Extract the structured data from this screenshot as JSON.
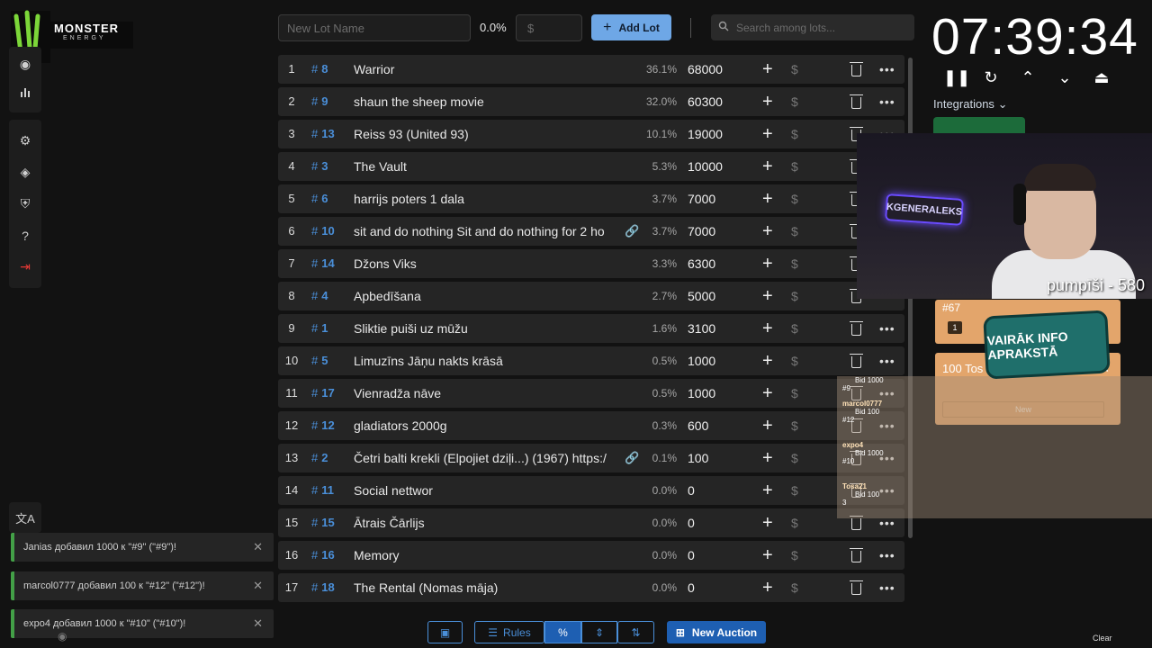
{
  "logo": {
    "text": "MONSTER",
    "sub": "ENERGY"
  },
  "top": {
    "lot_name_placeholder": "New Lot Name",
    "percent": "0.0%",
    "amount_placeholder": "$",
    "add_lot": "Add Lot",
    "search_placeholder": "Search among lots..."
  },
  "lots": [
    {
      "idx": "1",
      "id": "8",
      "name": "Warrior",
      "pct": "36.1%",
      "amount": "68000",
      "link": false
    },
    {
      "idx": "2",
      "id": "9",
      "name": "shaun the sheep movie",
      "pct": "32.0%",
      "amount": "60300",
      "link": false
    },
    {
      "idx": "3",
      "id": "13",
      "name": "Reiss 93 (United 93)",
      "pct": "10.1%",
      "amount": "19000",
      "link": false
    },
    {
      "idx": "4",
      "id": "3",
      "name": "The Vault",
      "pct": "5.3%",
      "amount": "10000",
      "link": false
    },
    {
      "idx": "5",
      "id": "6",
      "name": "harrijs poters 1 dala",
      "pct": "3.7%",
      "amount": "7000",
      "link": false
    },
    {
      "idx": "6",
      "id": "10",
      "name": "sit and do nothing Sit and do nothing for 2 ho",
      "pct": "3.7%",
      "amount": "7000",
      "link": true
    },
    {
      "idx": "7",
      "id": "14",
      "name": "Džons Viks",
      "pct": "3.3%",
      "amount": "6300",
      "link": false
    },
    {
      "idx": "8",
      "id": "4",
      "name": "Apbedīšana",
      "pct": "2.7%",
      "amount": "5000",
      "link": false
    },
    {
      "idx": "9",
      "id": "1",
      "name": "Sliktie puiši uz mūžu",
      "pct": "1.6%",
      "amount": "3100",
      "link": false
    },
    {
      "idx": "10",
      "id": "5",
      "name": "Limuzīns Jāņu nakts krāsā",
      "pct": "0.5%",
      "amount": "1000",
      "link": false
    },
    {
      "idx": "11",
      "id": "17",
      "name": "Vienradža nāve",
      "pct": "0.5%",
      "amount": "1000",
      "link": false
    },
    {
      "idx": "12",
      "id": "12",
      "name": "gladiators 2000g",
      "pct": "0.3%",
      "amount": "600",
      "link": false
    },
    {
      "idx": "13",
      "id": "2",
      "name": "Četri balti krekli (Elpojiet dziļi...) (1967) https:/",
      "pct": "0.1%",
      "amount": "100",
      "link": true
    },
    {
      "idx": "14",
      "id": "11",
      "name": "Social nettwor",
      "pct": "0.0%",
      "amount": "0",
      "link": false
    },
    {
      "idx": "15",
      "id": "15",
      "name": "Ātrais Čārlijs",
      "pct": "0.0%",
      "amount": "0",
      "link": false
    },
    {
      "idx": "16",
      "id": "16",
      "name": "Memory",
      "pct": "0.0%",
      "amount": "0",
      "link": false
    },
    {
      "idx": "17",
      "id": "18",
      "name": "The Rental (Nomas māja)",
      "pct": "0.0%",
      "amount": "0",
      "link": false
    }
  ],
  "toolbar": {
    "rules": "Rules",
    "new_auction": "New Auction",
    "percent_symbol": "%"
  },
  "notifications": [
    "Janias добавил 1000 к \"#9\" (\"#9\")!",
    "marcol0777 добавил 100 к \"#12\" (\"#12\")!",
    "expo4 добавил 1000 к \"#10\" (\"#10\")!"
  ],
  "timer": "07:39:34",
  "integrations": "Integrations",
  "cam": {
    "neon": "KGENERALEKS",
    "caption": "pumpīši - 580"
  },
  "cards": {
    "id67": "#67",
    "qty": "1",
    "title": "100 Tos",
    "promo": "VAIRĀK INFO APRAKSTĀ",
    "new_label": "New"
  },
  "bids": [
    {
      "who": "",
      "text": "Bid 1000",
      "ref": "#9"
    },
    {
      "who": "marcol0777",
      "text": "Bid 100",
      "ref": "#12"
    },
    {
      "who": "expo4",
      "text": "Bid 1000",
      "ref": "#10"
    },
    {
      "who": "Tosa21",
      "text": "Bid 100",
      "ref": "3"
    }
  ],
  "clear": "Clear",
  "colors": {
    "accent": "#4a8fd9",
    "add_lot_bg": "#6ea7e6",
    "notif_border": "#43a047",
    "card_orange": "#e3a56b"
  }
}
